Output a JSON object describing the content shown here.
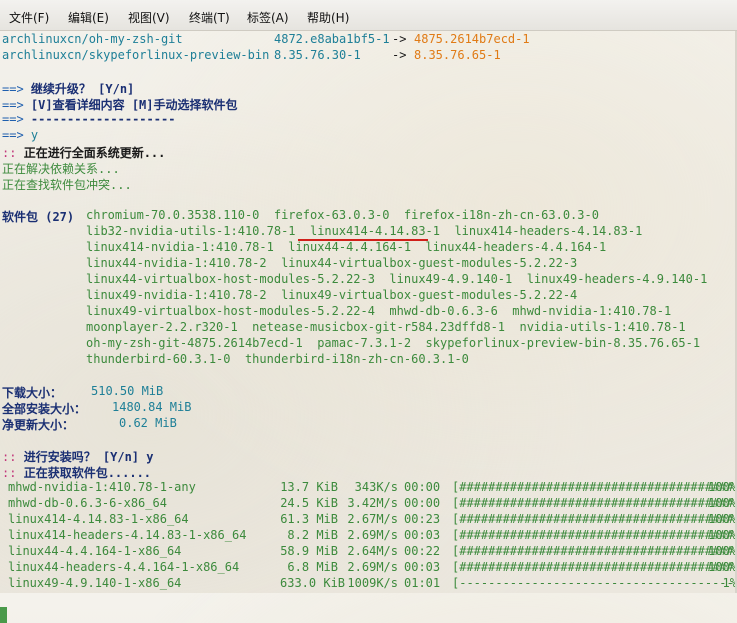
{
  "menu": [
    "文件(F)",
    "编辑(E)",
    "视图(V)",
    "终端(T)",
    "标签(A)",
    "帮助(H)"
  ],
  "top_updates": [
    {
      "name": "archlinuxcn/oh-my-zsh-git",
      "old": "4872.e8aba1bf5-1",
      "arrow": "->",
      "new": "4875.2614b7ecd-1"
    },
    {
      "name": "archlinuxcn/skypeforlinux-preview-bin",
      "old": "8.35.76.30-1",
      "arrow": "->",
      "new": "8.35.76.65-1"
    }
  ],
  "prompts": [
    {
      "arrow": "==>",
      "text": "继续升级？ [Y/n]"
    },
    {
      "arrow": "==>",
      "text": "[V]查看详细内容 [M]手动选择软件包"
    },
    {
      "arrow": "==>",
      "text": "--------------------"
    },
    {
      "arrow": "==>",
      "text": "y"
    }
  ],
  "sysupgrade": {
    "marker": "::",
    "text": "正在进行全面系统更新..."
  },
  "resolve_lines": [
    "正在解决依赖关系...",
    "正在查找软件包冲突..."
  ],
  "packages": {
    "label": "软件包 (27)",
    "lines": [
      "chromium-70.0.3538.110-0  firefox-63.0.3-0  firefox-i18n-zh-cn-63.0.3-0",
      "lib32-nvidia-utils-1:410.78-1  linux414-4.14.83-1  linux414-headers-4.14.83-1",
      "linux414-nvidia-1:410.78-1  linux44-4.4.164-1  linux44-headers-4.4.164-1",
      "linux44-nvidia-1:410.78-2  linux44-virtualbox-guest-modules-5.2.22-3",
      "linux44-virtualbox-host-modules-5.2.22-3  linux49-4.9.140-1  linux49-headers-4.9.140-1",
      "linux49-nvidia-1:410.78-2  linux49-virtualbox-guest-modules-5.2.22-4",
      "linux49-virtualbox-host-modules-5.2.22-4  mhwd-db-0.6.3-6  mhwd-nvidia-1:410.78-1",
      "moonplayer-2.2.r320-1  netease-musicbox-git-r584.23dffd8-1  nvidia-utils-1:410.78-1",
      "oh-my-zsh-git-4875.2614b7ecd-1  pamac-7.3.1-2  skypeforlinux-preview-bin-8.35.76.65-1",
      "thunderbird-60.3.1-0  thunderbird-i18n-zh-cn-60.3.1-0"
    ]
  },
  "sizes": [
    {
      "label": "下载大小：",
      "value": "510.50 MiB"
    },
    {
      "label": "全部安装大小：",
      "value": "1480.84 MiB"
    },
    {
      "label": "净更新大小：",
      "value": "0.62 MiB"
    }
  ],
  "install_prompt": {
    "marker": "::",
    "text": "进行安装吗？ [Y/n] y"
  },
  "fetch_line": {
    "marker": "::",
    "text": "正在获取软件包......"
  },
  "downloads": [
    {
      "name": "mhwd-nvidia-1:410.78-1-any",
      "size": "13.7 KiB",
      "speed": "343K/s",
      "time": "00:00",
      "bar": "[######################################]",
      "pct": "100%"
    },
    {
      "name": "mhwd-db-0.6.3-6-x86_64",
      "size": "24.5 KiB",
      "speed": "3.42M/s",
      "time": "00:00",
      "bar": "[######################################]",
      "pct": "100%"
    },
    {
      "name": "linux414-4.14.83-1-x86_64",
      "size": "61.3 MiB",
      "speed": "2.67M/s",
      "time": "00:23",
      "bar": "[######################################]",
      "pct": "100%"
    },
    {
      "name": "linux414-headers-4.14.83-1-x86_64",
      "size": "8.2 MiB",
      "speed": "2.69M/s",
      "time": "00:03",
      "bar": "[######################################]",
      "pct": "100%"
    },
    {
      "name": "linux44-4.4.164-1-x86_64",
      "size": "58.9 MiB",
      "speed": "2.64M/s",
      "time": "00:22",
      "bar": "[######################################]",
      "pct": "100%"
    },
    {
      "name": "linux44-headers-4.4.164-1-x86_64",
      "size": "6.8 MiB",
      "speed": "2.69M/s",
      "time": "00:03",
      "bar": "[######################################]",
      "pct": "100%"
    },
    {
      "name": "linux49-4.9.140-1-x86_64",
      "size": "633.0 KiB",
      "speed": "1009K/s",
      "time": "01:01",
      "bar": "[--------------------------------------]",
      "pct": "1%"
    }
  ]
}
